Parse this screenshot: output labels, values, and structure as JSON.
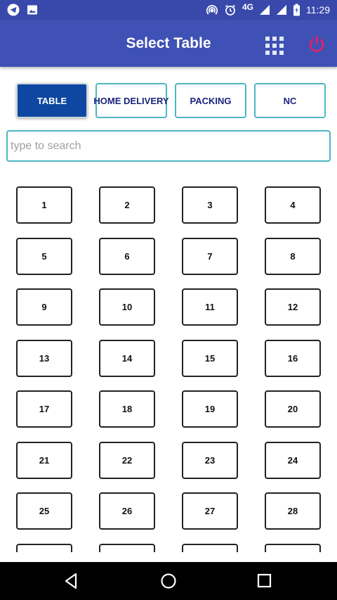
{
  "status_bar": {
    "left_icons": [
      "telegram-icon",
      "image-icon"
    ],
    "right_icons": [
      "hotspot-icon",
      "alarm-icon",
      "signal-icon",
      "signal-icon",
      "battery-icon"
    ],
    "network": "4G",
    "time": "11:29"
  },
  "app_bar": {
    "title": "Select Table",
    "actions": [
      "grid-icon",
      "power-icon"
    ],
    "background": "#3f51b5",
    "power_color": "#e91e63"
  },
  "tabs": [
    {
      "label": "TABLE",
      "active": true
    },
    {
      "label": "HOME DELIVERY",
      "active": false
    },
    {
      "label": "PACKING",
      "active": false
    },
    {
      "label": "NC",
      "active": false
    }
  ],
  "search": {
    "placeholder": "type to search",
    "value": ""
  },
  "tables": [
    "1",
    "2",
    "3",
    "4",
    "5",
    "6",
    "7",
    "8",
    "9",
    "10",
    "11",
    "12",
    "13",
    "14",
    "15",
    "16",
    "17",
    "18",
    "19",
    "20",
    "21",
    "22",
    "23",
    "24",
    "25",
    "26",
    "27",
    "28",
    "",
    "",
    "",
    ""
  ],
  "nav_bar": [
    "back-icon",
    "home-icon",
    "recents-icon"
  ],
  "colors": {
    "accent": "#0d47a1",
    "outline": "#4db6c2"
  }
}
